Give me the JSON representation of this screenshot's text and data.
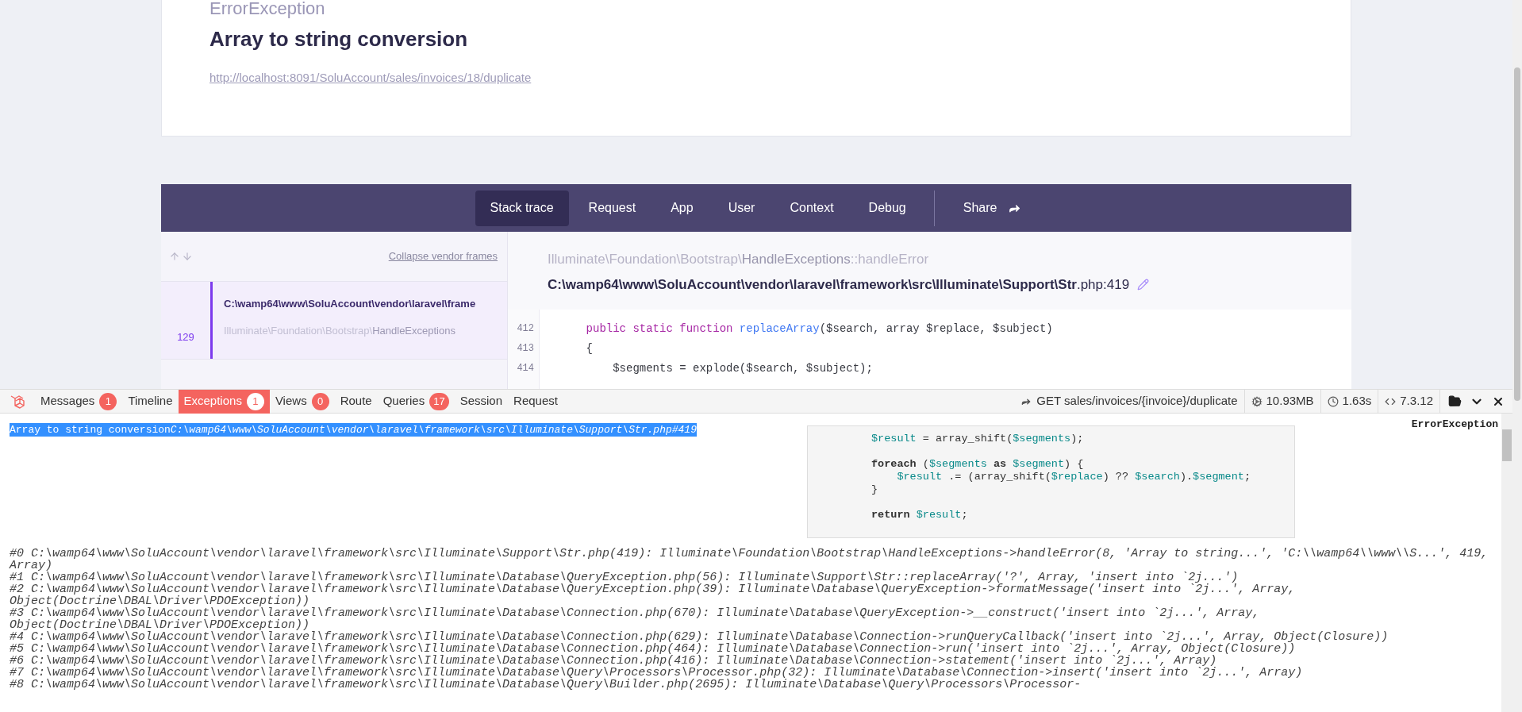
{
  "error": {
    "type": "ErrorException",
    "message": "Array to string conversion",
    "url": "http://localhost:8091/SoluAccount/sales/invoices/18/duplicate"
  },
  "nav": {
    "tabs": [
      {
        "label": "Stack trace",
        "selected": true
      },
      {
        "label": "Request",
        "selected": false
      },
      {
        "label": "App",
        "selected": false
      },
      {
        "label": "User",
        "selected": false
      },
      {
        "label": "Context",
        "selected": false
      },
      {
        "label": "Debug",
        "selected": false
      }
    ],
    "share": "Share"
  },
  "frames": {
    "collapse_link": "Collapse vendor frames",
    "items": [
      {
        "path": "C:\\wamp64\\www\\SoluAccount\\vendor\\laravel\\frame",
        "line": "129",
        "class_muted": "Illuminate\\Foundation\\Bootstrap\\",
        "class_name": "HandleExceptions",
        "selected": true
      }
    ]
  },
  "frame_detail": {
    "class_muted": "Illuminate\\Foundation\\Bootstrap\\",
    "class_name": "HandleExceptions",
    "method": "::handleError",
    "file_bold": "C:\\wamp64\\www\\SoluAccount\\vendor\\laravel\\framework\\src\\Illuminate\\Support\\Str",
    "file_rest": ".php:419",
    "code": [
      {
        "number": "412",
        "tokens": [
          {
            "kind": "keyword",
            "text": "public static function "
          },
          {
            "kind": "function",
            "text": "replaceArray"
          },
          {
            "kind": "plain",
            "text": "($search, array $replace, $subject)"
          }
        ]
      },
      {
        "number": "413",
        "tokens": [
          {
            "kind": "plain",
            "text": "{"
          }
        ]
      },
      {
        "number": "414",
        "tokens": [
          {
            "kind": "plain",
            "text": "    $segments = explode($search, $subject);"
          }
        ]
      }
    ]
  },
  "debugbar": {
    "tabs": [
      {
        "label": "Messages",
        "badge": "1",
        "selected": false
      },
      {
        "label": "Timeline",
        "selected": false
      },
      {
        "label": "Exceptions",
        "badge": "1",
        "selected": true
      },
      {
        "label": "Views",
        "badge": "0",
        "selected": false
      },
      {
        "label": "Route",
        "selected": false
      },
      {
        "label": "Queries",
        "badge": "17",
        "selected": false
      },
      {
        "label": "Session",
        "selected": false
      },
      {
        "label": "Request",
        "selected": false
      }
    ],
    "route": "GET sales/invoices/{invoice}/duplicate",
    "memory": "10.93MB",
    "time": "1.63s",
    "php_version": "7.3.12",
    "exception": {
      "type": "ErrorException",
      "message": "Array to string conversion",
      "location": "C:\\wamp64\\www\\SoluAccount\\vendor\\laravel\\framework\\src\\Illuminate\\Support\\Str.php#419",
      "code_blocks": [
        [
          [
            {
              "kind": "var",
              "text": "$result"
            },
            {
              "kind": "plain",
              "text": " = array_shift("
            },
            {
              "kind": "var",
              "text": "$segments"
            },
            {
              "kind": "plain",
              "text": ");"
            }
          ]
        ],
        [
          [
            {
              "kind": "keyword",
              "text": "foreach"
            },
            {
              "kind": "plain",
              "text": " ("
            },
            {
              "kind": "var",
              "text": "$segments"
            },
            {
              "kind": "keyword",
              "text": " as "
            },
            {
              "kind": "var",
              "text": "$segment"
            },
            {
              "kind": "plain",
              "text": ") {"
            }
          ],
          [
            {
              "kind": "var",
              "text": "    $result"
            },
            {
              "kind": "plain",
              "text": " .= (array_shift("
            },
            {
              "kind": "var",
              "text": "$replace"
            },
            {
              "kind": "plain",
              "text": ") ?? "
            },
            {
              "kind": "var",
              "text": "$search"
            },
            {
              "kind": "plain",
              "text": ")."
            },
            {
              "kind": "var",
              "text": "$segment"
            },
            {
              "kind": "plain",
              "text": ";"
            }
          ],
          [
            {
              "kind": "plain",
              "text": "}"
            }
          ]
        ],
        [
          [
            {
              "kind": "keyword",
              "text": "return "
            },
            {
              "kind": "var",
              "text": "$result"
            },
            {
              "kind": "plain",
              "text": ";"
            }
          ]
        ]
      ],
      "trace": [
        "#0 C:\\wamp64\\www\\SoluAccount\\vendor\\laravel\\framework\\src\\Illuminate\\Support\\Str.php(419): Illuminate\\Foundation\\Bootstrap\\HandleExceptions->handleError(8, 'Array to string...', 'C:\\\\wamp64\\\\www\\\\S...', 419, Array)",
        "#1 C:\\wamp64\\www\\SoluAccount\\vendor\\laravel\\framework\\src\\Illuminate\\Database\\QueryException.php(56): Illuminate\\Support\\Str::replaceArray('?', Array, 'insert into `2j...')",
        "#2 C:\\wamp64\\www\\SoluAccount\\vendor\\laravel\\framework\\src\\Illuminate\\Database\\QueryException.php(39): Illuminate\\Database\\QueryException->formatMessage('insert into `2j...', Array, Object(Doctrine\\DBAL\\Driver\\PDOException))",
        "#3 C:\\wamp64\\www\\SoluAccount\\vendor\\laravel\\framework\\src\\Illuminate\\Database\\Connection.php(670): Illuminate\\Database\\QueryException->__construct('insert into `2j...', Array, Object(Doctrine\\DBAL\\Driver\\PDOException))",
        "#4 C:\\wamp64\\www\\SoluAccount\\vendor\\laravel\\framework\\src\\Illuminate\\Database\\Connection.php(629): Illuminate\\Database\\Connection->runQueryCallback('insert into `2j...', Array, Object(Closure))",
        "#5 C:\\wamp64\\www\\SoluAccount\\vendor\\laravel\\framework\\src\\Illuminate\\Database\\Connection.php(464): Illuminate\\Database\\Connection->run('insert into `2j...', Array, Object(Closure))",
        "#6 C:\\wamp64\\www\\SoluAccount\\vendor\\laravel\\framework\\src\\Illuminate\\Database\\Connection.php(416): Illuminate\\Database\\Connection->statement('insert into `2j...', Array)",
        "#7 C:\\wamp64\\www\\SoluAccount\\vendor\\laravel\\framework\\src\\Illuminate\\Database\\Query\\Processors\\Processor.php(32): Illuminate\\Database\\Connection->insert('insert into `2j...', Array)",
        "#8 C:\\wamp64\\www\\SoluAccount\\vendor\\laravel\\framework\\src\\Illuminate\\Database\\Query\\Builder.php(2695): Illuminate\\Database\\Query\\Processors\\Processor-"
      ]
    }
  }
}
